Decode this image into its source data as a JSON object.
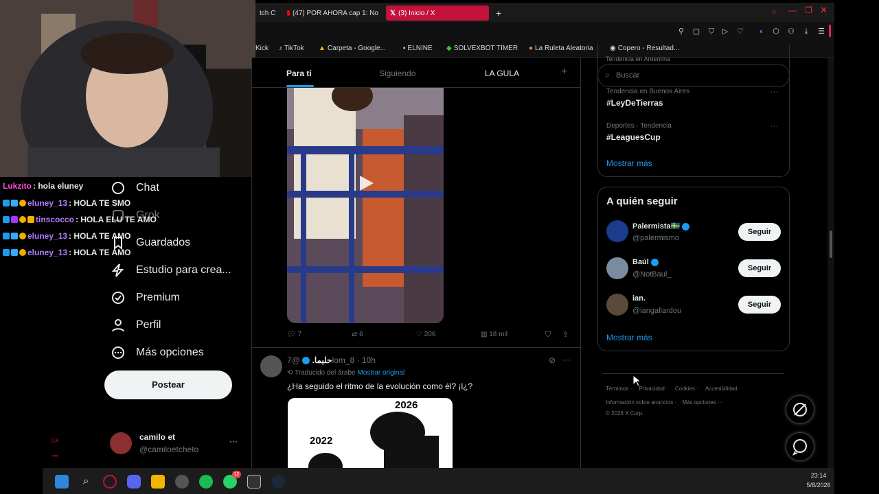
{
  "browser": {
    "tabs": [
      {
        "label": "tch C",
        "icon": "twitch-icon"
      },
      {
        "label": "(47) POR AHORA cap 1: No",
        "icon": "youtube-icon"
      },
      {
        "label": "(3) Inicio / X",
        "icon": "x-icon"
      }
    ],
    "bookmarks": [
      {
        "label": "Kick"
      },
      {
        "label": "TikTok"
      },
      {
        "label": "Carpeta - Google..."
      },
      {
        "label": "ELNINE"
      },
      {
        "label": "SOLVEXBOT TIMER"
      },
      {
        "label": "La Ruleta Aleatoria"
      },
      {
        "label": "Copero - Resultad..."
      }
    ]
  },
  "chat": [
    {
      "user": "Lukzito",
      "msg": ": hola eluney",
      "color": "#ff4fd8"
    },
    {
      "user": "eluney_13",
      "msg": ": HOLA TE SMO",
      "color": "#b57bff"
    },
    {
      "user": "tinscocco",
      "msg": ": HOLA ELU TE AMO",
      "color": "#b57bff"
    },
    {
      "user": "eluney_13",
      "msg": ": HOLA TE AMO",
      "color": "#b57bff"
    },
    {
      "user": "eluney_13",
      "msg": ": HOLA TE AMO",
      "color": "#b57bff"
    }
  ],
  "sidenav": {
    "items": [
      {
        "label": "Chat",
        "icon": "chat-icon"
      },
      {
        "label": "Grok",
        "icon": "grok-icon"
      },
      {
        "label": "Guardados",
        "icon": "bookmark-icon"
      },
      {
        "label": "Estudio para crea...",
        "icon": "lightning-icon"
      },
      {
        "label": "Premium",
        "icon": "premium-icon"
      },
      {
        "label": "Perfil",
        "icon": "profile-icon"
      },
      {
        "label": "Más opciones",
        "icon": "more-options-icon"
      }
    ],
    "post_button": "Postear",
    "account_name": "camilo et",
    "account_handle": "@camiloetcheto",
    "gx_label": "GX"
  },
  "feed": {
    "tabs": [
      "Para ti",
      "Siguiendo",
      "LA GULA"
    ],
    "post1": {
      "replies": "7",
      "reposts": "6",
      "likes": "206",
      "views": "18 mil"
    },
    "post2": {
      "name": "حليما.",
      "handle": "@7lom_8 · 10h",
      "translated": "Traducido del árabe",
      "show_original": "Mostrar original",
      "text": "¿Ha seguido el ritmo de la evolución como él? ¡l¿?",
      "label_2026": "2026",
      "label_2022": "2022"
    }
  },
  "search": {
    "placeholder": "Buscar"
  },
  "trends": {
    "top_cut": "Tendencia en Argentina",
    "items": [
      {
        "context": "Tendencia en Buenos Aires",
        "tag": "#LeyDeTierras"
      },
      {
        "context": "Deportes · Tendencia",
        "tag": "#LeaguesCup"
      }
    ],
    "show_more": "Mostrar más"
  },
  "who_to_follow": {
    "title": "A quién seguir",
    "accounts": [
      {
        "name": "Palermista🇸🇪",
        "handle": "@palermismo",
        "button": "Seguir"
      },
      {
        "name": "Baúl",
        "handle": "@NotBaul_",
        "button": "Seguir"
      },
      {
        "name": "ian.",
        "handle": "@iangallardou",
        "button": "Seguir"
      }
    ],
    "show_more": "Mostrar más"
  },
  "footer": {
    "links1": [
      "Términos",
      "Privacidad",
      "Cookies",
      "Accesibilidad"
    ],
    "links2": [
      "Información sobre anuncios",
      "Más opciones ···"
    ],
    "copyright": "© 2026 X Corp."
  },
  "taskbar": {
    "time": "23:14",
    "date": "5/8/2026",
    "whatsapp_badge": "12"
  },
  "colors": {
    "x_blue": "#1d9bf0",
    "opera_red": "#c2123b",
    "border": "#2f3336"
  }
}
